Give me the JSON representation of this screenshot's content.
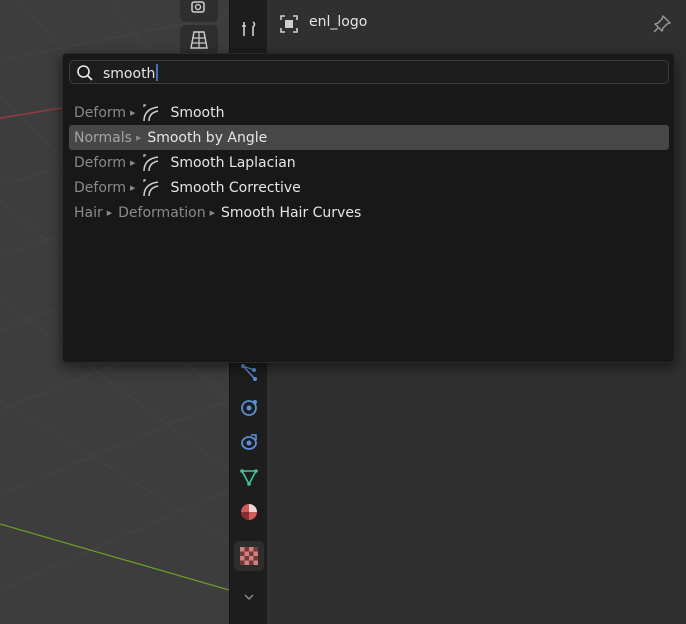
{
  "properties": {
    "object_name": "enl_logo"
  },
  "search": {
    "query": "smooth"
  },
  "results": [
    {
      "path": [
        "Deform"
      ],
      "label": "Smooth",
      "icon": "deform-modifier-icon",
      "highlighted": false
    },
    {
      "path": [
        "Normals"
      ],
      "label": "Smooth by Angle",
      "icon": "",
      "highlighted": true
    },
    {
      "path": [
        "Deform"
      ],
      "label": "Smooth Laplacian",
      "icon": "deform-modifier-icon",
      "highlighted": false
    },
    {
      "path": [
        "Deform"
      ],
      "label": "Smooth Corrective",
      "icon": "deform-modifier-icon",
      "highlighted": false
    },
    {
      "path": [
        "Hair",
        "Deformation"
      ],
      "label": "Smooth Hair Curves",
      "icon": "",
      "highlighted": false
    }
  ],
  "colors": {
    "accent": "#4772b3",
    "highlight_row": "#474747",
    "popup_bg": "#181818",
    "tab_blue": "#5b8fd6",
    "tab_green": "#3ec89a",
    "tab_red": "#d15c5c"
  }
}
